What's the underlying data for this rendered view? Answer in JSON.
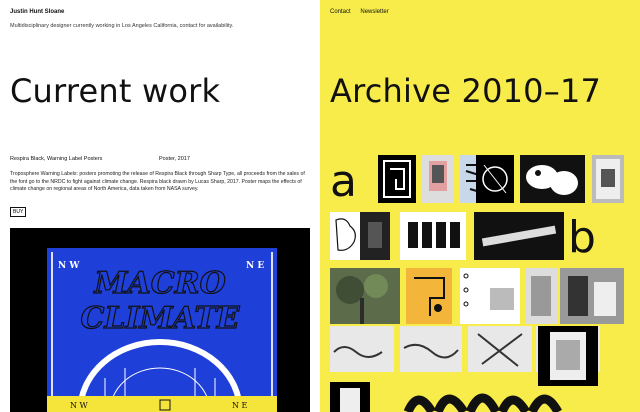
{
  "author": {
    "name": "Justin Hunt Sloane",
    "bio": "Multidisciplinary designer currently working in Los Angeles California, contact for availability."
  },
  "nav": {
    "contact": "Contact",
    "newsletter": "Newsletter"
  },
  "current": {
    "heading": "Current work",
    "project": {
      "name": "Respira Black, Warning Label Posters",
      "type": "Poster, 2017",
      "description": "Troposphere Warning Labels: posters promoting the release of Respira Black through Sharp Type, all proceeds from the sales of the font go to the NRDC to fight against climate change. Respira black drawn by Lucas Sharp, 2017. Poster maps the effects of climate change on regional areas of North America, data taken from NASA survey.",
      "buy_label": "BUY",
      "poster": {
        "line1": "MACRO",
        "line2": "CLIMATE",
        "corner_left": "N W",
        "corner_right": "N E"
      }
    }
  },
  "archive": {
    "heading": "Archive 2010–17",
    "section_a": "a",
    "section_b": "b"
  },
  "colors": {
    "archive_bg": "#f8ec4b",
    "poster_blue": "#1f3fd9",
    "poster_yellow": "#f5e53a"
  }
}
